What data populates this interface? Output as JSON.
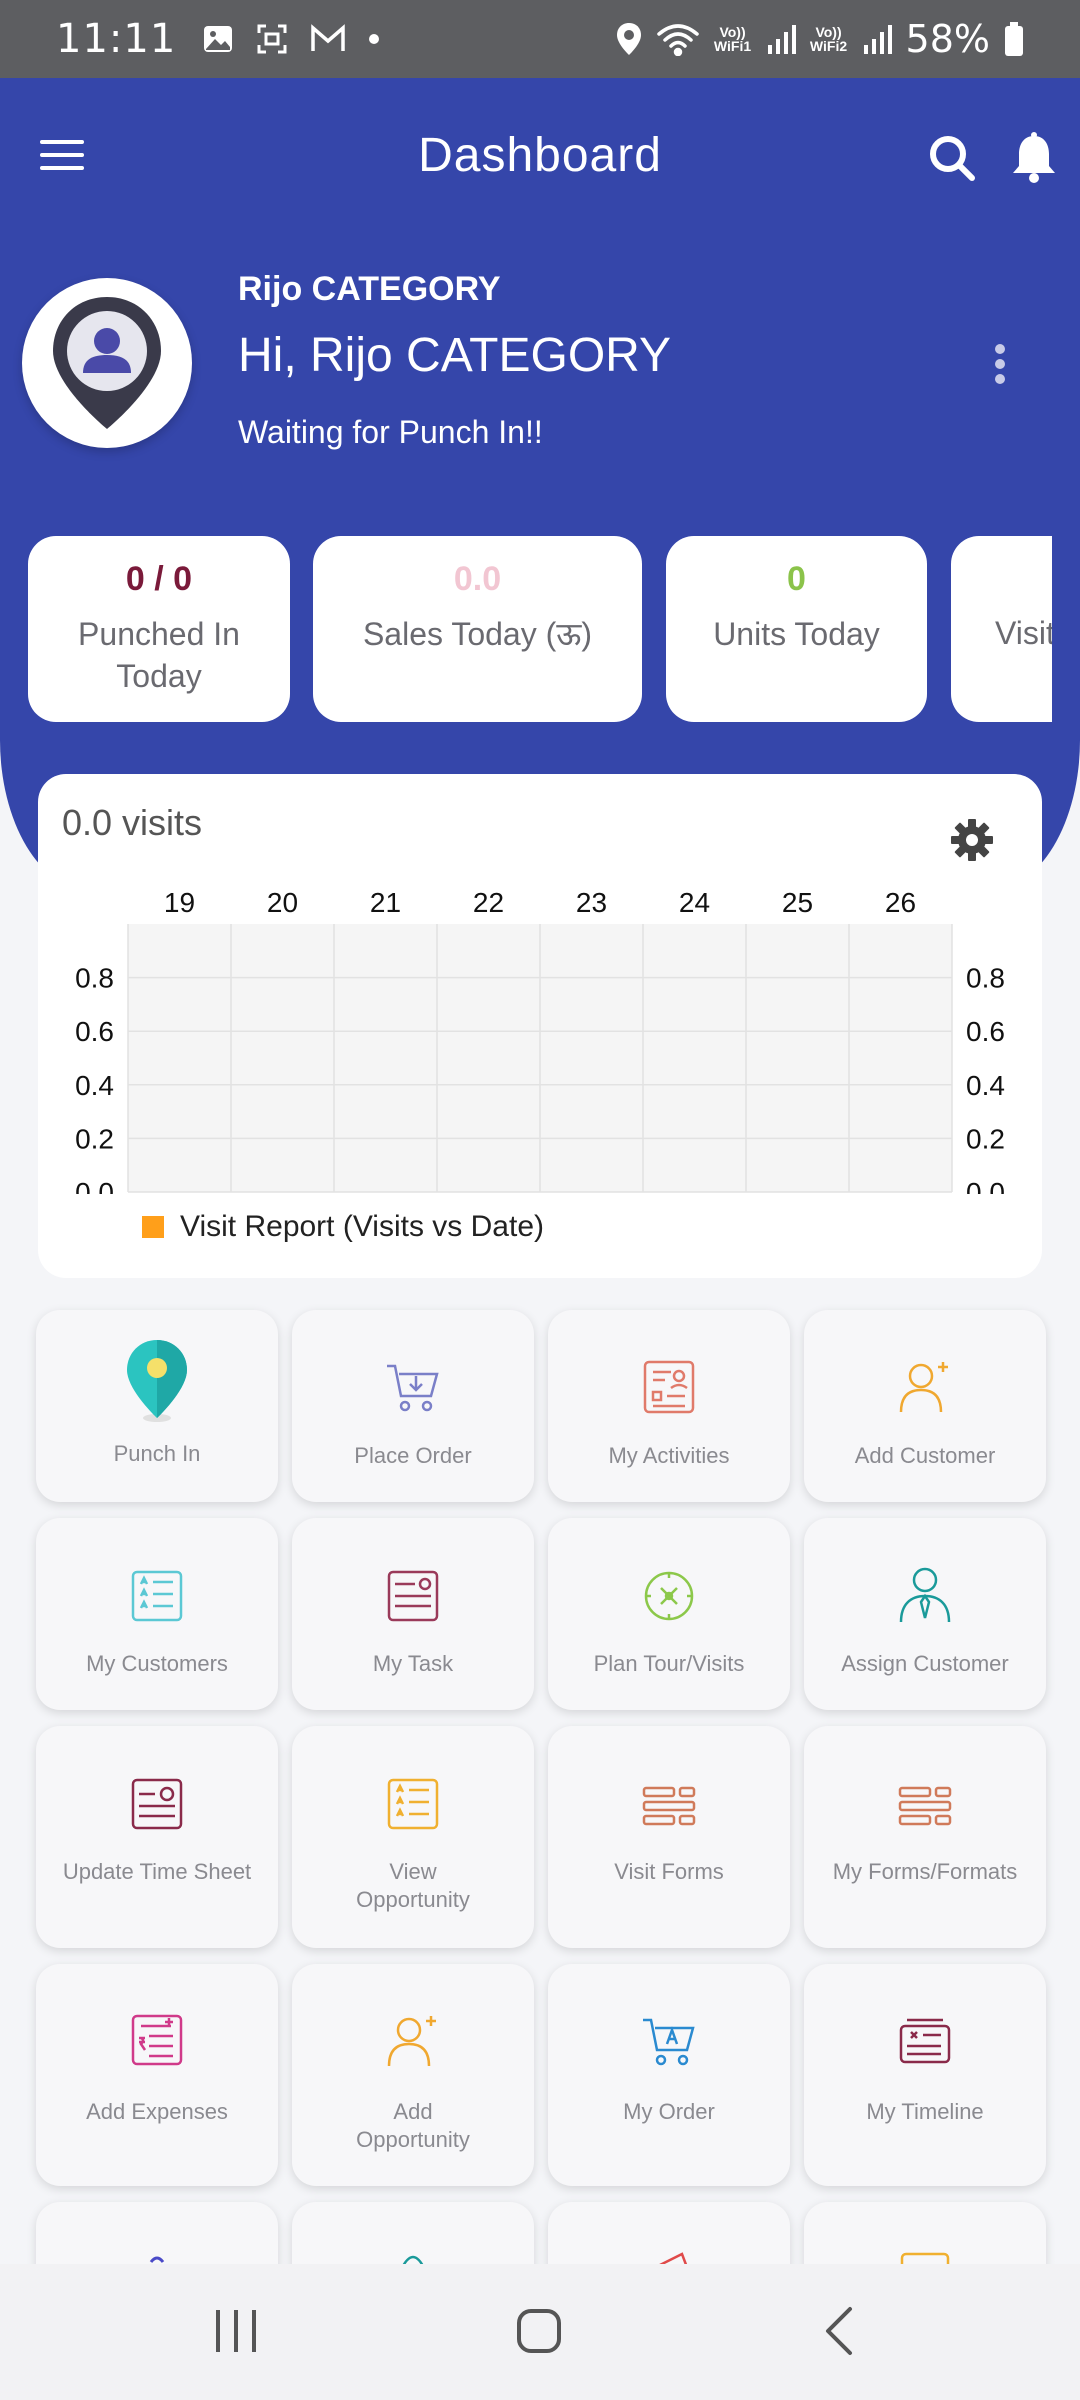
{
  "status_bar": {
    "time": "11:11",
    "wifi1": "Vo)) WiFi1",
    "wifi2": "Vo)) WiFi2",
    "battery": "58%"
  },
  "header": {
    "title": "Dashboard",
    "menu_icon": "hamburger-icon",
    "search_icon": "search-icon",
    "bell_icon": "bell-icon"
  },
  "profile": {
    "name": "Rijo CATEGORY",
    "greeting": "Hi, Rijo CATEGORY",
    "status": "Waiting for Punch In!!"
  },
  "stats": [
    {
      "value": "0 / 0",
      "label": "Punched In Today",
      "color": "#7a1a3a"
    },
    {
      "value": "0.0",
      "label": "Sales Today (ऊ)",
      "color": "#f2c6d2"
    },
    {
      "value": "0",
      "label": "Units Today",
      "color": "#8bc34a"
    },
    {
      "value": "",
      "label": "Visit",
      "color": "#999999"
    }
  ],
  "chart_data": {
    "type": "bar",
    "title": "0.0 visits",
    "categories": [
      "19",
      "20",
      "21",
      "22",
      "23",
      "24",
      "25",
      "26"
    ],
    "series": [
      {
        "name": "Visit Report (Visits vs Date)",
        "values": [
          0,
          0,
          0,
          0,
          0,
          0,
          0,
          0
        ],
        "color": "#ff9f1a"
      }
    ],
    "y_ticks": [
      "0.8",
      "0.6",
      "0.4",
      "0.2",
      "0.0"
    ],
    "ylim": [
      0,
      1
    ],
    "grid": true,
    "legend_placement": "bottom-left"
  },
  "tiles": [
    {
      "label": "Punch In",
      "icon": "map-pin-icon",
      "color": "#2bc4c0"
    },
    {
      "label": "Place Order",
      "icon": "cart-icon",
      "color": "#7a7fc8"
    },
    {
      "label": "My Activities",
      "icon": "activities-icon",
      "color": "#e07a6a"
    },
    {
      "label": "Add Customer",
      "icon": "add-user-icon",
      "color": "#f0a830"
    },
    {
      "label": "My Customers",
      "icon": "list-icon",
      "color": "#5bc8d4"
    },
    {
      "label": "My Task",
      "icon": "task-icon",
      "color": "#9a3a5a"
    },
    {
      "label": "Plan Tour/Visits",
      "icon": "compass-icon",
      "color": "#8cc84a"
    },
    {
      "label": "Assign Customer",
      "icon": "user-tie-icon",
      "color": "#1a9a9a"
    },
    {
      "label": "Update Time Sheet",
      "icon": "timesheet-icon",
      "color": "#8a2a4a"
    },
    {
      "label": "View Opportunity",
      "icon": "list-icon",
      "color": "#f0b030"
    },
    {
      "label": "Visit Forms",
      "icon": "forms-icon",
      "color": "#d07a5a"
    },
    {
      "label": "My Forms/Formats",
      "icon": "forms-icon",
      "color": "#d07a5a"
    },
    {
      "label": "Add Expenses",
      "icon": "expenses-icon",
      "color": "#d03a8a"
    },
    {
      "label": "Add Opportunity",
      "icon": "add-user-icon",
      "color": "#f0a830"
    },
    {
      "label": "My Order",
      "icon": "order-cart-icon",
      "color": "#2a8ad0"
    },
    {
      "label": "My Timeline",
      "icon": "timeline-icon",
      "color": "#8a2a4a"
    },
    {
      "label": "",
      "icon": "partial-icon",
      "color": "#4a4ac8"
    },
    {
      "label": "",
      "icon": "partial-icon",
      "color": "#1a9a9a"
    },
    {
      "label": "",
      "icon": "partial-icon",
      "color": "#e04a4a"
    },
    {
      "label": "",
      "icon": "partial-icon",
      "color": "#f0b030"
    }
  ],
  "nav": {
    "recents": "recents-icon",
    "home": "home-icon",
    "back": "back-icon"
  }
}
